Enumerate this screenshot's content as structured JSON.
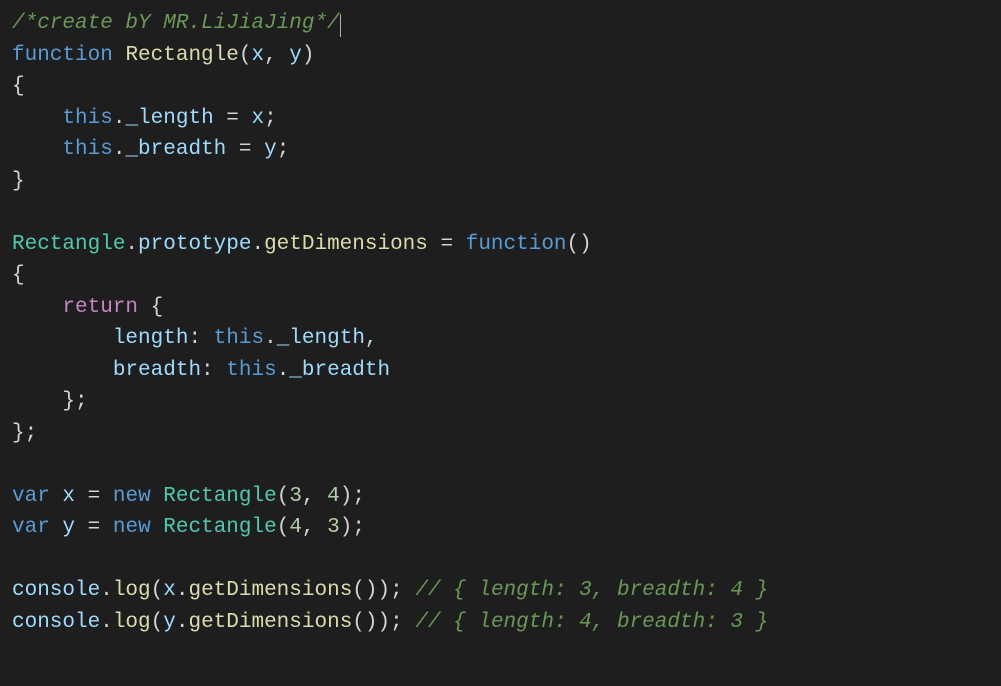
{
  "code": {
    "l1_comment": "/*create bY MR.LiJiaJing*/",
    "l2_fn": "function",
    "l2_name": "Rectangle",
    "l2_p1": "x",
    "l2_p2": "y",
    "l4_this": "this",
    "l4_prop": "_length",
    "l4_var": "x",
    "l5_this": "this",
    "l5_prop": "_breadth",
    "l5_var": "y",
    "l8_class": "Rectangle",
    "l8_proto": "prototype",
    "l8_method": "getDimensions",
    "l8_fn": "function",
    "l10_return": "return",
    "l11_key": "length",
    "l11_this": "this",
    "l11_prop": "_length",
    "l12_key": "breadth",
    "l12_this": "this",
    "l12_prop": "_breadth",
    "l16_var": "var",
    "l16_x": "x",
    "l16_new": "new",
    "l16_class": "Rectangle",
    "l16_n1": "3",
    "l16_n2": "4",
    "l17_var": "var",
    "l17_y": "y",
    "l17_new": "new",
    "l17_class": "Rectangle",
    "l17_n1": "4",
    "l17_n2": "3",
    "l19_console": "console",
    "l19_log": "log",
    "l19_x": "x",
    "l19_method": "getDimensions",
    "l19_comment": "// { length: 3, breadth: 4 }",
    "l20_console": "console",
    "l20_log": "log",
    "l20_y": "y",
    "l20_method": "getDimensions",
    "l20_comment": "// { length: 4, breadth: 3 }"
  }
}
